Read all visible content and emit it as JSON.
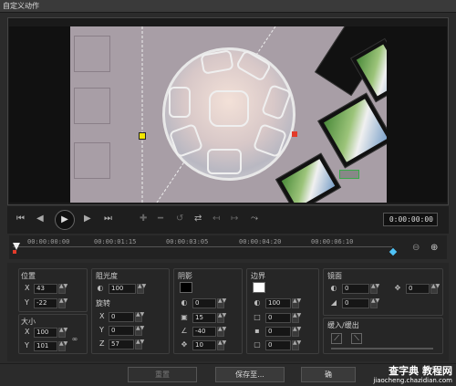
{
  "window": {
    "title": "自定义动作"
  },
  "playback": {
    "timecode": "0:00:00:00"
  },
  "ruler": {
    "ticks": [
      "00:00:00:00",
      "00:00:01:15",
      "00:00:03:05",
      "00:00:04:20",
      "00:00:06:10"
    ]
  },
  "position": {
    "label": "位置",
    "x_label": "X",
    "x_value": "43",
    "y_label": "Y",
    "y_value": "-22"
  },
  "size": {
    "label": "大小",
    "x_label": "X",
    "x_value": "100",
    "y_label": "Y",
    "y_value": "101"
  },
  "opacity": {
    "label": "阻光度",
    "value": "100"
  },
  "rotation": {
    "label": "旋转",
    "x_label": "X",
    "x_value": "0",
    "y_label": "Y",
    "y_value": "0",
    "z_label": "Z",
    "z_value": "57"
  },
  "shadow": {
    "label": "阴影",
    "color": "#000000",
    "opacity": "0",
    "blur": "15",
    "direction": "-40",
    "distance": "10"
  },
  "border": {
    "label": "边界",
    "color": "#ffffff",
    "opacity": "100",
    "v1": "0",
    "v2": "0",
    "v3": "0"
  },
  "mirror": {
    "label": "镜面",
    "v1": "0",
    "v2": "0",
    "v3": "0"
  },
  "ease": {
    "label": "缓入/缓出"
  },
  "footer": {
    "reset": "重置",
    "save": "保存至...",
    "ok": "确"
  },
  "watermark": {
    "line1": "查字典 教程网",
    "line2": "jiaocheng.chazidian.com"
  },
  "colors": {
    "accent_cyan": "#4fc3f7",
    "handle_yellow": "#f2e600",
    "handle_red": "#e23b2a",
    "handle_green": "#3aa84a"
  }
}
